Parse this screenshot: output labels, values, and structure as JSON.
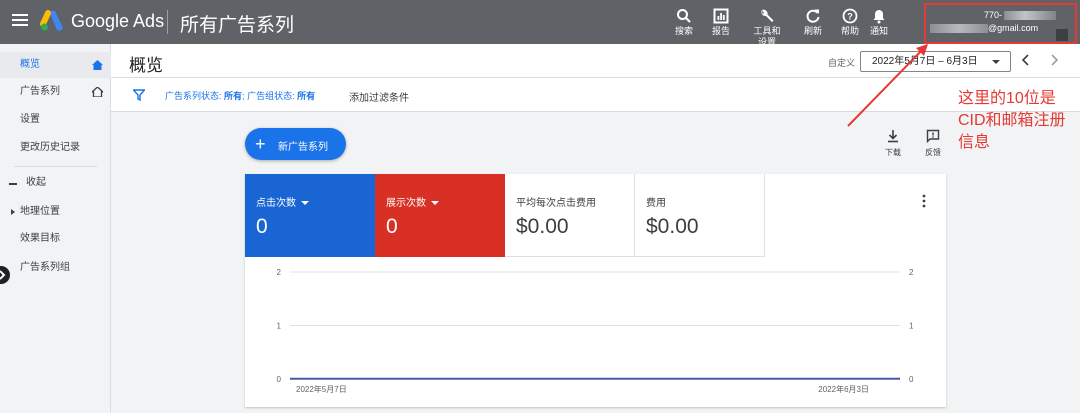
{
  "topbar": {
    "brand": "Google Ads",
    "page_title": "所有广告系列",
    "buttons": [
      {
        "label": "搜索",
        "icon": "search-icon"
      },
      {
        "label": "报告",
        "icon": "reports-icon"
      },
      {
        "label": "工具和设置",
        "icon": "wrench-icon"
      },
      {
        "label": "刷新",
        "icon": "refresh-icon"
      },
      {
        "label": "帮助",
        "icon": "help-icon"
      },
      {
        "label": "通知",
        "icon": "bell-icon"
      }
    ],
    "account": {
      "id_prefix": "770-",
      "email_suffix": "@gmail.com"
    }
  },
  "sidebar": {
    "items": [
      {
        "label": "概览",
        "active": true
      },
      {
        "label": "广告系列"
      },
      {
        "label": "设置"
      },
      {
        "label": "更改历史记录"
      },
      {
        "label": "收起"
      },
      {
        "label": "地理位置"
      },
      {
        "label": "效果目标"
      },
      {
        "label": "广告系列组"
      }
    ]
  },
  "header": {
    "title": "概览",
    "custom_label": "自定义",
    "date_range": "2022年5月7日 – 6月3日"
  },
  "filter": {
    "campaign_status_label": "广告系列状态:",
    "campaign_status_value": "所有",
    "adgroup_status_label": "广告组状态:",
    "adgroup_status_value": "所有",
    "add_filter": "添加过滤条件"
  },
  "actions": {
    "new_campaign": "新广告系列",
    "download": "下载",
    "feedback": "反馈"
  },
  "metrics": [
    {
      "label": "点击次数",
      "value": "0",
      "color": "#1a65d4"
    },
    {
      "label": "展示次数",
      "value": "0",
      "color": "#d93025"
    },
    {
      "label": "平均每次点击费用",
      "value": "$0.00"
    },
    {
      "label": "费用",
      "value": "$0.00"
    }
  ],
  "chart_data": {
    "type": "line",
    "x": [
      "2022年5月7日",
      "2022年6月3日"
    ],
    "x_tick_labels": [
      "2022年5月7日",
      "2022年6月3日"
    ],
    "series": [
      {
        "values": [
          0,
          0
        ],
        "color": "#d93025"
      },
      {
        "values": [
          0,
          0
        ],
        "color": "#1a65d4"
      }
    ],
    "y_left_ticks": [
      "2",
      "1",
      "0"
    ],
    "y_right_ticks": [
      "2",
      "1",
      "0"
    ],
    "ylim": [
      0,
      2
    ],
    "grid": true
  },
  "annotation": {
    "lines": [
      "这里的10位是",
      "CID和邮箱注册",
      "信息"
    ],
    "color": "#e53935"
  }
}
